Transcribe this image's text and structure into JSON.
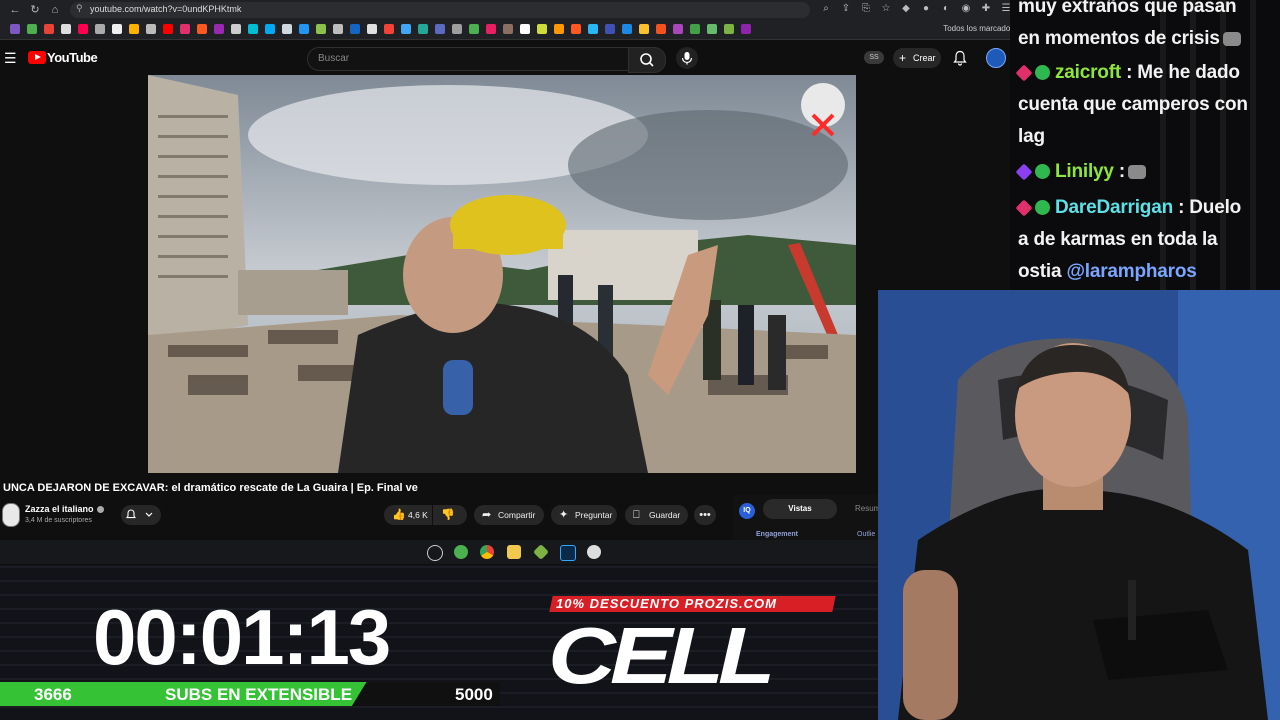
{
  "browser": {
    "url": "youtube.com/watch?v=0undKPHKtmk",
    "bookmarks_all_label": "Todos los marcador"
  },
  "youtube": {
    "logo_text": "YouTube",
    "search_placeholder": "Buscar",
    "ss_badge": "SS",
    "create_label": "Crear",
    "video_title": "UNCA DEJARON DE EXCAVAR: el dramático rescate de La Guaira | Ep. Final ve",
    "channel_name": "Zazza el italiano",
    "subscribers": "3,4 M de suscriptores",
    "like_count": "4,6 K",
    "share_label": "Compartir",
    "ask_label": "Preguntar",
    "save_label": "Guardar",
    "ext": {
      "iq_label": "IQ",
      "tab_active": "Vistas",
      "tab_other": "Resum",
      "engagement": "Engagement",
      "outlier": "Outlie"
    }
  },
  "chat": {
    "line1": "muy extraños que pasan",
    "line2": "en momentos de crisis",
    "msg1_user": "zaicroft",
    "msg1_text1": ": Me he dado",
    "msg1_text2": "cuenta que camperos con",
    "msg1_text3": "lag",
    "msg2_user": "Linilyy",
    "msg2_text": ":",
    "msg3_user": "DareDarrigan",
    "msg3_text1": ": Duelo",
    "msg3_text2": "a de karmas en toda la",
    "msg3_text3": "ostia",
    "msg3_mention": "@larampharos"
  },
  "overlay": {
    "timer": "00:01:13",
    "subs_current": "3666",
    "subs_label": "SUBS EN EXTENSIBLE",
    "subs_goal": "5000",
    "subs_progress": 0.733,
    "promo_text": "10% DESCUENTO PROZIS.COM",
    "cell_logo": "CELL"
  },
  "colors": {
    "youtube_red": "#ff0000",
    "progress_green": "#35c235",
    "promo_red": "#d81f26",
    "chat_user_green": "#8ee63a",
    "chat_user_cyan": "#5ce1e6",
    "mention_blue": "#7aa6ff"
  }
}
